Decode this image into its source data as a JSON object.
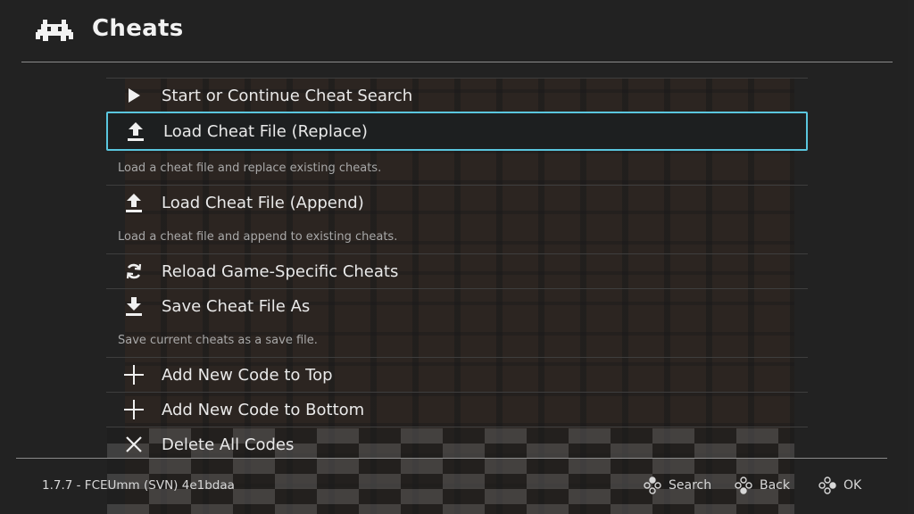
{
  "header": {
    "title": "Cheats"
  },
  "menu": {
    "items": [
      {
        "label": "Start or Continue Cheat Search",
        "icon": "play-icon"
      },
      {
        "label": "Load Cheat File (Replace)",
        "icon": "upload-icon",
        "desc": "Load a cheat file and replace existing cheats."
      },
      {
        "label": "Load Cheat File (Append)",
        "icon": "upload-icon",
        "desc": "Load a cheat file and append to existing cheats."
      },
      {
        "label": "Reload Game-Specific Cheats",
        "icon": "reload-icon"
      },
      {
        "label": "Save Cheat File As",
        "icon": "download-icon",
        "desc": "Save current cheats as a save file."
      },
      {
        "label": "Add New Code to Top",
        "icon": "plus-icon"
      },
      {
        "label": "Add New Code to Bottom",
        "icon": "plus-icon"
      },
      {
        "label": "Delete All Codes",
        "icon": "close-icon"
      }
    ]
  },
  "footer": {
    "version": "1.7.7 - FCEUmm (SVN) 4e1bdaa",
    "hints": {
      "search": "Search",
      "back": "Back",
      "ok": "OK"
    }
  },
  "colors": {
    "accent": "#5ac6de",
    "background": "#232323"
  }
}
